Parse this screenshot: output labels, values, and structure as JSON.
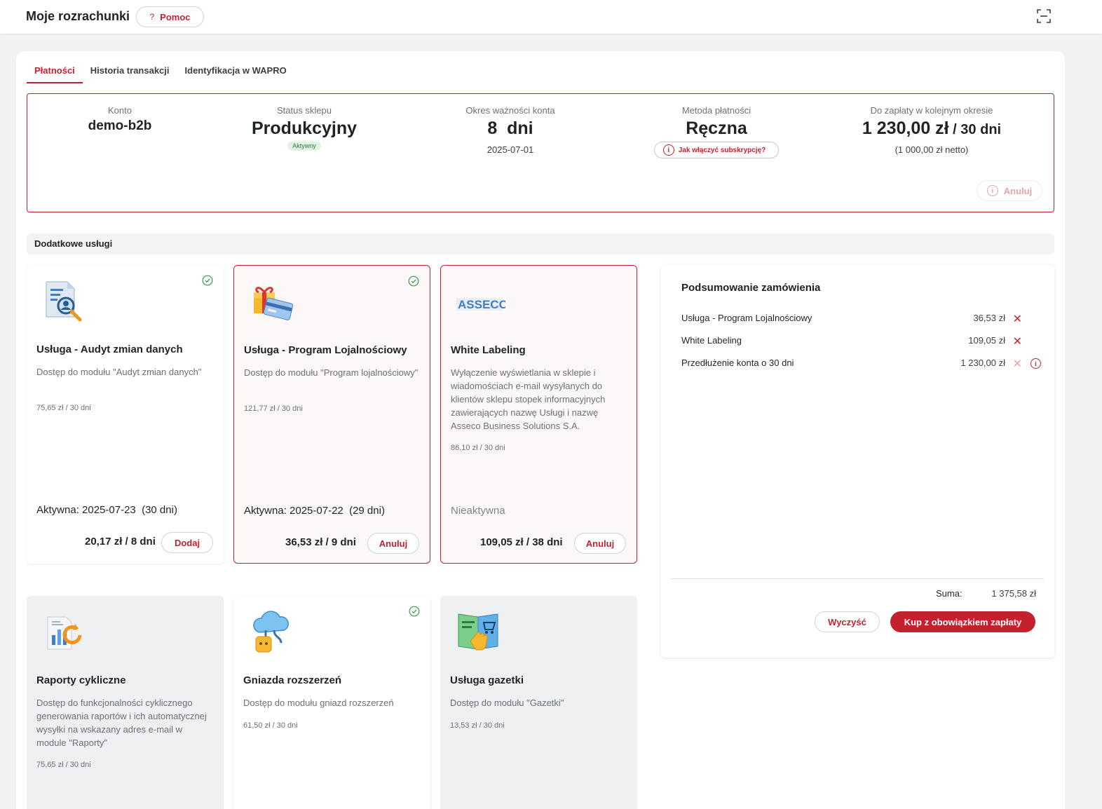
{
  "header": {
    "title": "Moje rozrachunki",
    "help_label": "Pomoc"
  },
  "tabs": [
    {
      "label": "Płatności",
      "active": true
    },
    {
      "label": "Historia transakcji",
      "active": false
    },
    {
      "label": "Identyfikacja w WAPRO",
      "active": false
    }
  ],
  "info": {
    "account": {
      "label": "Konto",
      "value": "demo-b2b"
    },
    "status": {
      "label": "Status sklepu",
      "value": "Produkcyjny",
      "badge": "Aktywny"
    },
    "validity": {
      "label": "Okres ważności konta",
      "value": "8  dni",
      "date": "2025-07-01"
    },
    "method": {
      "label": "Metoda płatności",
      "value": "Ręczna",
      "hint": "Jak włączyć subskrypcję?"
    },
    "due": {
      "label": "Do zapłaty w kolejnym okresie",
      "value": "1 230,00 zł",
      "period": " / 30 dni",
      "net": "(1 000,00 zł netto)"
    },
    "cancel_label": "Anuluj"
  },
  "section_title": "Dodatkowe usługi",
  "services": [
    {
      "title": "Usługa - Audyt zmian danych",
      "desc": "Dostęp do modułu \"Audyt zmian danych\"",
      "price": "75,65 zł / 30 dni",
      "status": "Aktywna: 2025-07-23  (30 dni)",
      "total": "20,17 zł / 8 dni",
      "button": "Dodaj",
      "checked": true,
      "icon": "document-search-icon"
    },
    {
      "title": "Usługa - Program Lojalnościowy",
      "desc": "Dostęp do modułu \"Program lojalnościowy\"",
      "price": "121,77 zł / 30 dni",
      "status": "Aktywna: 2025-07-22  (29 dni)",
      "total": "36,53 zł / 9 dni",
      "button": "Anuluj",
      "checked": true,
      "icon": "gift-card-icon"
    },
    {
      "title": "White Labeling",
      "desc": "Wyłączenie wyświetlania w sklepie i wiadomościach e-mail wysyłanych do klientów sklepu stopek informacyjnych zawierających nazwę Usługi i nazwę Asseco Business Solutions S.A.",
      "price": "86,10 zł / 30 dni",
      "status": "Nieaktywna",
      "total": "109,05 zł / 38 dni",
      "button": "Anuluj",
      "checked": false,
      "icon": "asseco-logo",
      "logo_text": "ASSECO"
    },
    {
      "title": "Raporty cykliczne",
      "desc": "Dostęp do funkcjonalności cyklicznego generowania raportów i ich automatycznej wysyłki na wskazany adres e-mail w module \"Raporty\"",
      "price": "75,65 zł / 30 dni",
      "checked": false,
      "icon": "report-cycle-icon"
    },
    {
      "title": "Gniazda rozszerzeń",
      "desc": "Dostęp do modułu gniazd rozszerzeń",
      "price": "61,50 zł / 30 dni",
      "checked": true,
      "icon": "cloud-plug-icon"
    },
    {
      "title": "Usługa gazetki",
      "desc": "Dostęp do modułu \"Gazetki\"",
      "price": "13,53 zł / 30 dni",
      "checked": false,
      "icon": "catalog-cart-icon"
    }
  ],
  "summary": {
    "title": "Podsumowanie zamówienia",
    "items": [
      {
        "name": "Usługa - Program Lojalnościowy",
        "price": "36,53 zł"
      },
      {
        "name": "White Labeling",
        "price": "109,05 zł"
      },
      {
        "name": "Przedłużenie konta o 30 dni",
        "price": "1 230,00 zł"
      }
    ],
    "total_label": "Suma:",
    "total_value": "1 375,58 zł",
    "clear_label": "Wyczyść",
    "buy_label": "Kup z obowiązkiem zapłaty"
  },
  "colors": {
    "accent": "#c4212f",
    "success": "#3c9a4f"
  }
}
